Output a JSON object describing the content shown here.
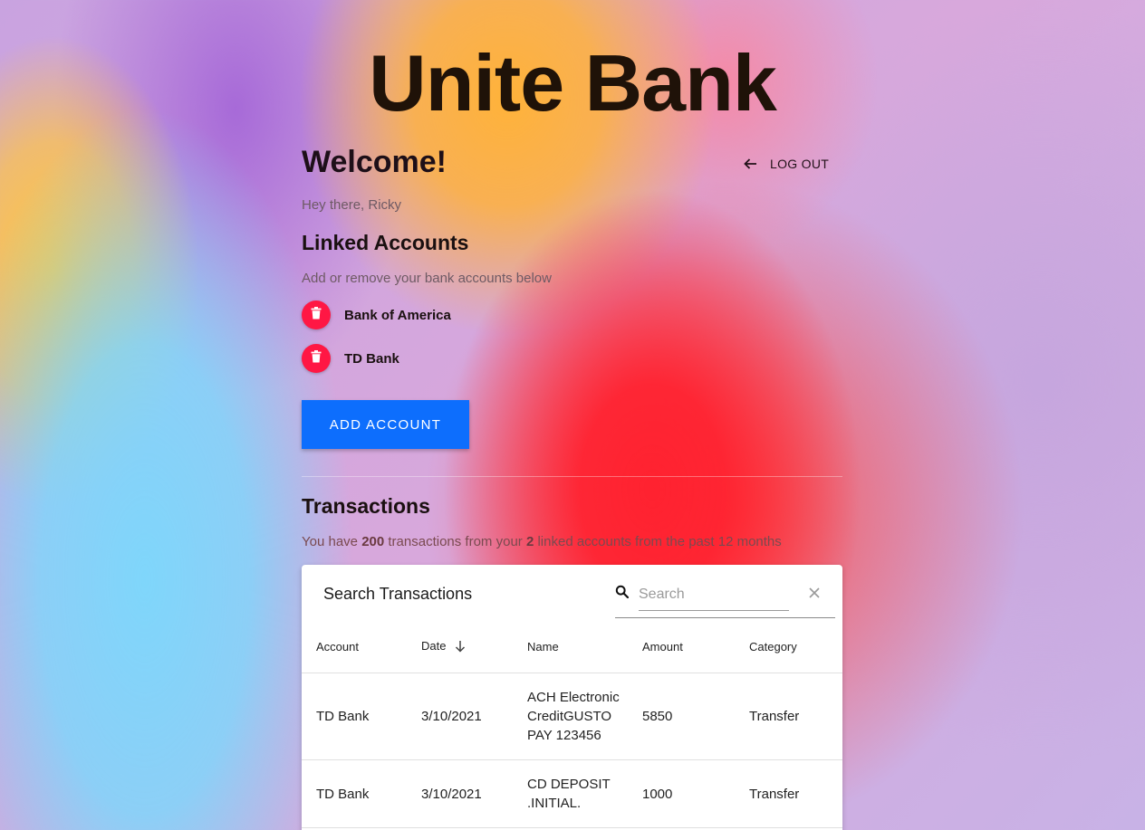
{
  "app": {
    "title": "Unite Bank"
  },
  "header": {
    "welcome": "Welcome!",
    "logout_label": "LOG OUT",
    "greeting": "Hey there, Ricky"
  },
  "linked_accounts": {
    "title": "Linked Accounts",
    "description": "Add or remove your bank accounts below",
    "accounts": [
      {
        "name": "Bank of America",
        "icon": "trash-icon"
      },
      {
        "name": "TD Bank",
        "icon": "trash-icon"
      }
    ],
    "add_button_label": "ADD ACCOUNT"
  },
  "transactions": {
    "title": "Transactions",
    "summary": {
      "prefix": "You have ",
      "count": "200",
      "middle": " transactions from your ",
      "accounts": "2",
      "suffix": " linked accounts from the past 12 months"
    },
    "table": {
      "title": "Search Transactions",
      "search_placeholder": "Search",
      "columns": [
        "Account",
        "Date",
        "Name",
        "Amount",
        "Category"
      ],
      "sorted_column": "Date",
      "sort_direction": "descending",
      "rows": [
        [
          "TD Bank",
          "3/10/2021",
          "ACH Electronic CreditGUSTO PAY 123456",
          "5850",
          "Transfer"
        ],
        [
          "TD Bank",
          "3/10/2021",
          "CD DEPOSIT .INITIAL.",
          "1000",
          "Transfer"
        ]
      ]
    }
  },
  "colors": {
    "delete_button": "#ff1744",
    "primary_button": "#0d6efd",
    "title_text": "#1f1208"
  }
}
